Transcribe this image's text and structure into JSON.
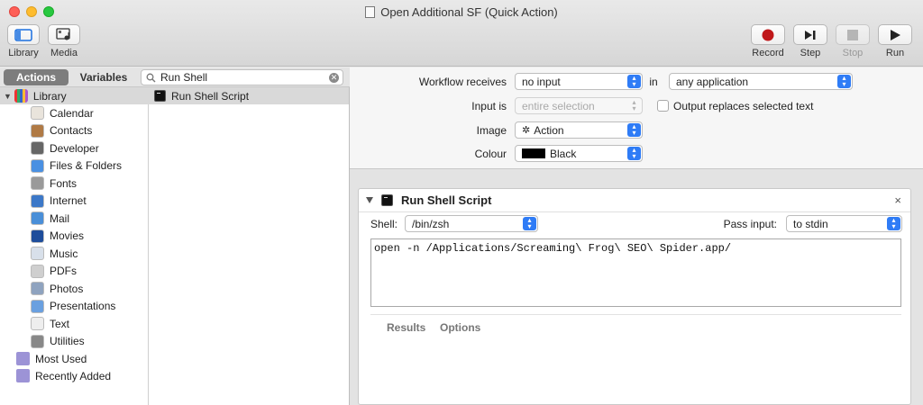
{
  "window": {
    "title": "Open Additional SF (Quick Action)"
  },
  "toolbar": {
    "library": "Library",
    "media": "Media",
    "record": "Record",
    "step": "Step",
    "stop": "Stop",
    "run": "Run"
  },
  "left": {
    "tab_actions": "Actions",
    "tab_variables": "Variables",
    "search_value": "Run Shell",
    "library_root": "Library",
    "categories": [
      {
        "label": "Calendar",
        "icon": "calendar-icon"
      },
      {
        "label": "Contacts",
        "icon": "contacts-icon"
      },
      {
        "label": "Developer",
        "icon": "developer-icon"
      },
      {
        "label": "Files & Folders",
        "icon": "finder-icon"
      },
      {
        "label": "Fonts",
        "icon": "fonts-icon"
      },
      {
        "label": "Internet",
        "icon": "globe-icon"
      },
      {
        "label": "Mail",
        "icon": "mail-icon"
      },
      {
        "label": "Movies",
        "icon": "quicktime-icon"
      },
      {
        "label": "Music",
        "icon": "music-icon"
      },
      {
        "label": "PDFs",
        "icon": "pdf-icon"
      },
      {
        "label": "Photos",
        "icon": "photos-icon"
      },
      {
        "label": "Presentations",
        "icon": "presentation-icon"
      },
      {
        "label": "Text",
        "icon": "text-icon"
      },
      {
        "label": "Utilities",
        "icon": "utilities-icon"
      }
    ],
    "most_used": "Most Used",
    "recently_added": "Recently Added",
    "action_result": "Run Shell Script"
  },
  "workflow": {
    "receives_label": "Workflow receives",
    "receives_value": "no input",
    "in_label": "in",
    "in_value": "any application",
    "input_is_label": "Input is",
    "input_is_value": "entire selection",
    "output_replaces": "Output replaces selected text",
    "image_label": "Image",
    "image_value": "Action",
    "colour_label": "Colour",
    "colour_value": "Black",
    "colour_swatch": "#000000"
  },
  "action": {
    "title": "Run Shell Script",
    "shell_label": "Shell:",
    "shell_value": "/bin/zsh",
    "pass_input_label": "Pass input:",
    "pass_input_value": "to stdin",
    "script": "open -n /Applications/Screaming\\ Frog\\ SEO\\ Spider.app/",
    "tab_results": "Results",
    "tab_options": "Options",
    "close_glyph": "×"
  },
  "colors": {
    "accent": "#2f7cf6",
    "record": "#c0181a"
  }
}
